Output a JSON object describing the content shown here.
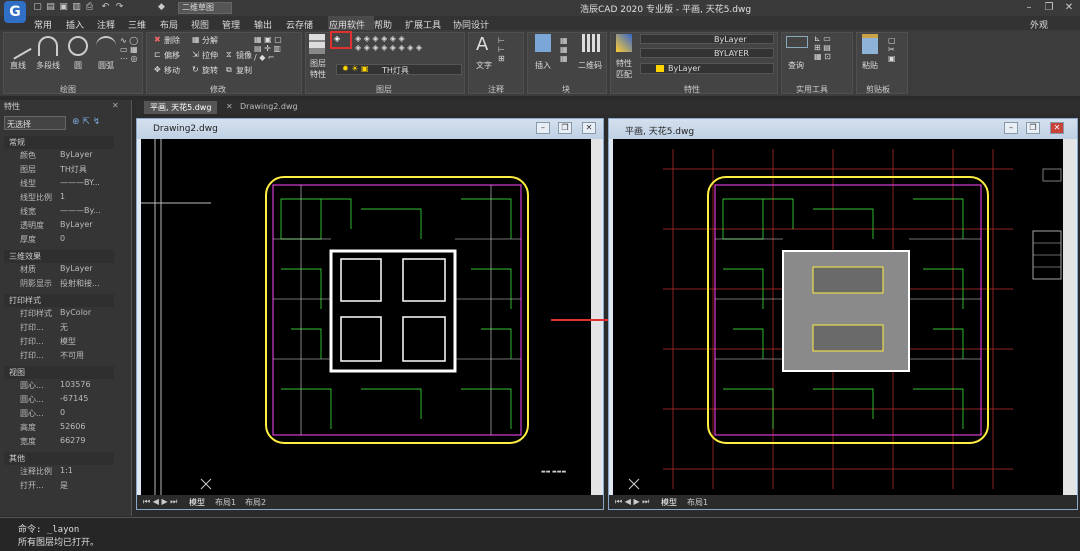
{
  "app": {
    "title": "浩辰CAD 2020 专业版 - 平画, 天花5.dwg",
    "logo": "G",
    "workspace": "二维草图",
    "right_label": "外观"
  },
  "quick_access": [
    "new-icon",
    "open-icon",
    "save-icon",
    "saveas-icon",
    "print-icon",
    "undo-icon",
    "redo-icon",
    "cube-icon"
  ],
  "menu": [
    "常用",
    "插入",
    "注释",
    "三维",
    "布局",
    "视图",
    "管理",
    "输出",
    "云存储",
    "应用软件",
    "帮助",
    "扩展工具",
    "协同设计"
  ],
  "ribbon": {
    "draw": {
      "label": "绘图",
      "items": [
        "直线",
        "多段线",
        "圆",
        "圆弧"
      ]
    },
    "modify": {
      "label": "修改",
      "items": [
        "删除",
        "分解",
        "偏移",
        "拉伸",
        "移动",
        "旋转",
        "镜像",
        "复制"
      ]
    },
    "layer": {
      "label": "图层",
      "big": "图层\n特性",
      "current": "TH灯具"
    },
    "annotation": {
      "label": "注释",
      "big": "文字"
    },
    "block": {
      "label": "块",
      "big": "插入",
      "big2": "二维码"
    },
    "properties": {
      "label": "特性",
      "big": "特性\n匹配",
      "color": "ByLayer",
      "linetype": "ByLayer",
      "lineweight": "BYLAYER"
    },
    "util": {
      "label": "实用工具",
      "big": "查询"
    },
    "clip": {
      "label": "剪贴板",
      "big": "粘贴"
    }
  },
  "doc_tabs": [
    "平画, 天花5.dwg",
    "Drawing2.dwg"
  ],
  "properties_panel": {
    "title": "特性",
    "selection": "无选择",
    "sections": [
      {
        "cat": "常规",
        "rows": [
          [
            "颜色",
            "ByLayer"
          ],
          [
            "图层",
            "TH灯具"
          ],
          [
            "线型",
            "———BY..."
          ],
          [
            "线型比例",
            "1"
          ],
          [
            "线宽",
            "———By..."
          ],
          [
            "透明度",
            "ByLayer"
          ],
          [
            "厚度",
            "0"
          ]
        ]
      },
      {
        "cat": "三维效果",
        "rows": [
          [
            "材质",
            "ByLayer"
          ],
          [
            "阴影显示",
            "投射和接..."
          ]
        ]
      },
      {
        "cat": "打印样式",
        "rows": [
          [
            "打印样式",
            "ByColor"
          ],
          [
            "打印...",
            "无"
          ],
          [
            "打印...",
            "模型"
          ],
          [
            "打印...",
            "不可用"
          ]
        ]
      },
      {
        "cat": "视图",
        "rows": [
          [
            "圆心...",
            "103576"
          ],
          [
            "圆心...",
            "-67145"
          ],
          [
            "圆心...",
            "0"
          ],
          [
            "高度",
            "52606"
          ],
          [
            "宽度",
            "66279"
          ]
        ]
      },
      {
        "cat": "其他",
        "rows": [
          [
            "注释比例",
            "1:1"
          ],
          [
            "打开...",
            "是"
          ]
        ]
      }
    ]
  },
  "win_left": {
    "title": "Drawing2.dwg",
    "tabs": [
      "模型",
      "布局1",
      "布局2"
    ]
  },
  "win_right": {
    "title": "平画, 天花5.dwg",
    "tabs": [
      "模型",
      "布局1"
    ]
  },
  "command": {
    "line1": "命令: _layon",
    "line2": "所有图层均已打开。"
  },
  "colors": {
    "accent": "#2f6fc6",
    "highlight": "#e03030",
    "canvas": "#000000"
  }
}
